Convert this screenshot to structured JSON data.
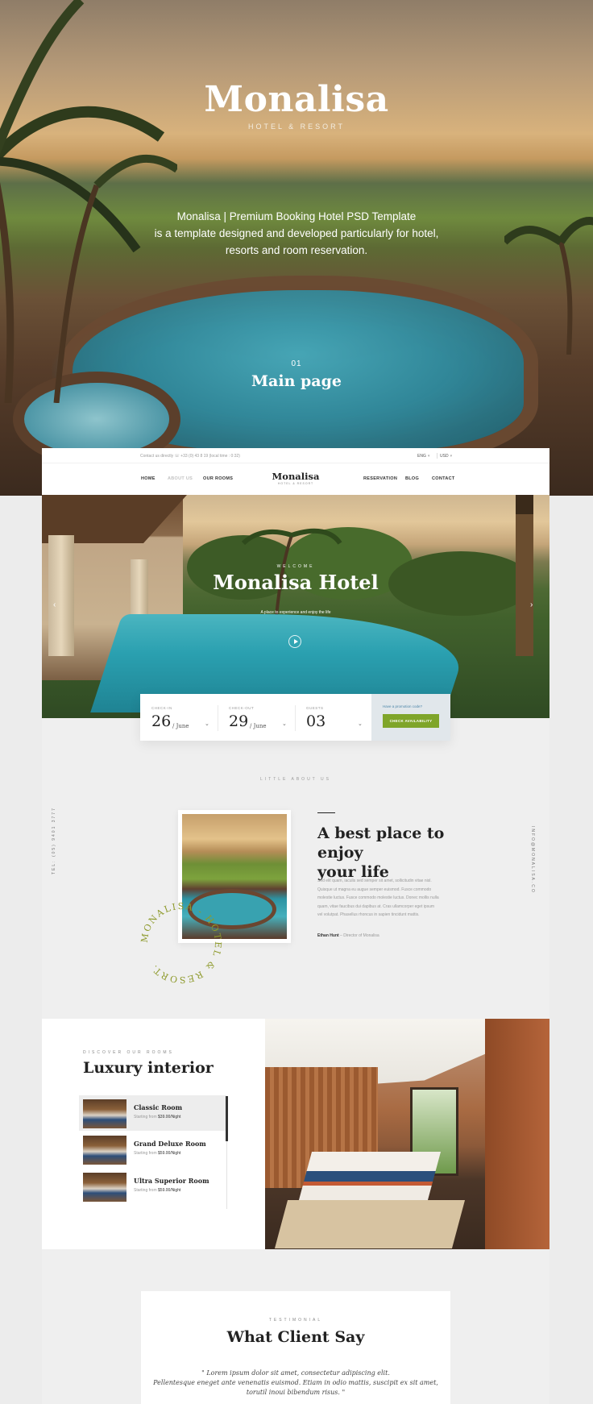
{
  "hero": {
    "brand": "Monalisa",
    "brand_sub": "HOTEL & RESORT",
    "description": [
      "Monalisa | Premium Booking Hotel PSD Template",
      "is a template designed and developed particularly for hotel,",
      "resorts and room reservation."
    ],
    "page_number": "01",
    "page_name": "Main page"
  },
  "topbar": {
    "contact": "Contact us directly ☏ +33 (0) 43 8 19 (local time : 0:32)",
    "currency": "ENG",
    "language": "USD"
  },
  "nav": {
    "items": [
      "HOME",
      "ABOUT US",
      "OUR ROOMS",
      "RESERVATION",
      "BLOG",
      "CONTACT"
    ],
    "logo": "Monalisa",
    "logo_sub": "HOTEL & RESORT"
  },
  "slider": {
    "welcome": "WELCOME",
    "title": "Monalisa Hotel",
    "subtitle": "A place to experience and enjoy the life"
  },
  "booking": {
    "checkin_label": "CHECK-IN",
    "checkin_day": "26",
    "checkin_month": "/ June",
    "checkout_label": "CHECK-OUT",
    "checkout_day": "29",
    "checkout_month": "/ June",
    "guests_label": "GUESTS",
    "guests_value": "03",
    "promo_text": "Have a promotion code?",
    "check_button": "CHECK AVAILABILITY"
  },
  "about": {
    "label": "LITTLE ABOUT US",
    "tel": "TEL: (05) 9401 3777",
    "email": "INFO@MONALISA.CO",
    "circle_text": "MONALISA - HOTEL & RESORT.",
    "heading_line1": "A best place to enjoy",
    "heading_line2": "your life",
    "body": [
      "Sed elit quam, iaculis sed semper sit amet, sollicitudin vitae nisl.",
      "Quisque ut magna eu augue semper euismod. Fusce commodo",
      "molestie luctus. Fusce commodo molestie luctus. Donec mollis nulla",
      "quam, vitae faucibus dui dapibus at. Cras ullamcorper eget ipsum",
      "vel volutpat. Phasellus rhoncus in sapien tincidunt mattis."
    ],
    "signature_name": "Ethan Hunt",
    "signature_role": " – Director of Monalisa"
  },
  "rooms": {
    "label": "DISCOVER OUR ROOMS",
    "title": "Luxury interior",
    "items": [
      {
        "name": "Classic Room",
        "price_prefix": "Starting from ",
        "price": "$39.00/Night"
      },
      {
        "name": "Grand Deluxe Room",
        "price_prefix": "Starting from ",
        "price": "$59.00/Night"
      },
      {
        "name": "Ultra Superior Room",
        "price_prefix": "Starting from ",
        "price": "$59.00/Night"
      }
    ]
  },
  "testimonial": {
    "label": "TESTIMONIAL",
    "title": "What Client Say",
    "quote": [
      "\" Lorem ipsum dolor sit amet, consectetur adipiscing elit.",
      "Pellentesque  eneget ante venenatis euismod. Etiam in odio mattis, suscipit ex sit amet,",
      "torutil inoui bibendum risus. \""
    ]
  },
  "colors": {
    "accent_green": "#7fa52a",
    "promo_bg": "#e1e7eb",
    "link_blue": "#4d86a8"
  }
}
